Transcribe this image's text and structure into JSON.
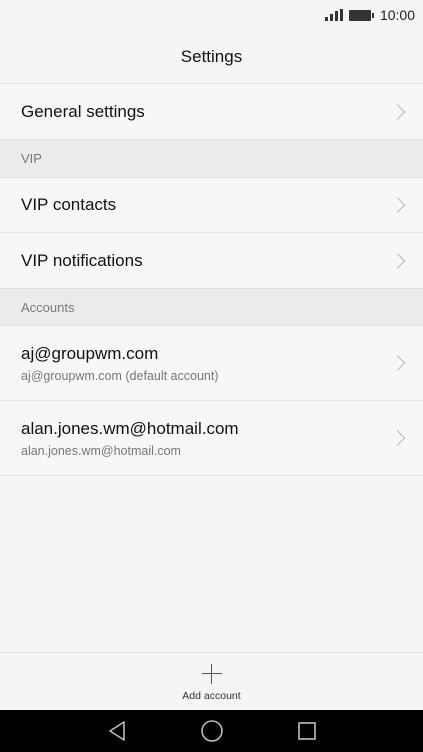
{
  "status_bar": {
    "time": "10:00",
    "signal_icon": "signal-icon",
    "battery_icon": "battery-icon"
  },
  "header": {
    "title": "Settings"
  },
  "general": {
    "label": "General settings"
  },
  "vip": {
    "section_label": "VIP",
    "contacts_label": "VIP contacts",
    "notifications_label": "VIP notifications"
  },
  "accounts": {
    "section_label": "Accounts",
    "items": [
      {
        "title": "aj@groupwm.com",
        "subtitle": "aj@groupwm.com (default account)"
      },
      {
        "title": "alan.jones.wm@hotmail.com",
        "subtitle": "alan.jones.wm@hotmail.com"
      }
    ]
  },
  "footer": {
    "add_account_label": "Add account",
    "add_icon": "plus-icon"
  },
  "nav": {
    "back_icon": "back-icon",
    "home_icon": "home-icon",
    "recents_icon": "recents-icon"
  },
  "colors": {
    "background": "#f5f5f5",
    "section": "#ebebeb",
    "nav_bar": "#000000"
  }
}
